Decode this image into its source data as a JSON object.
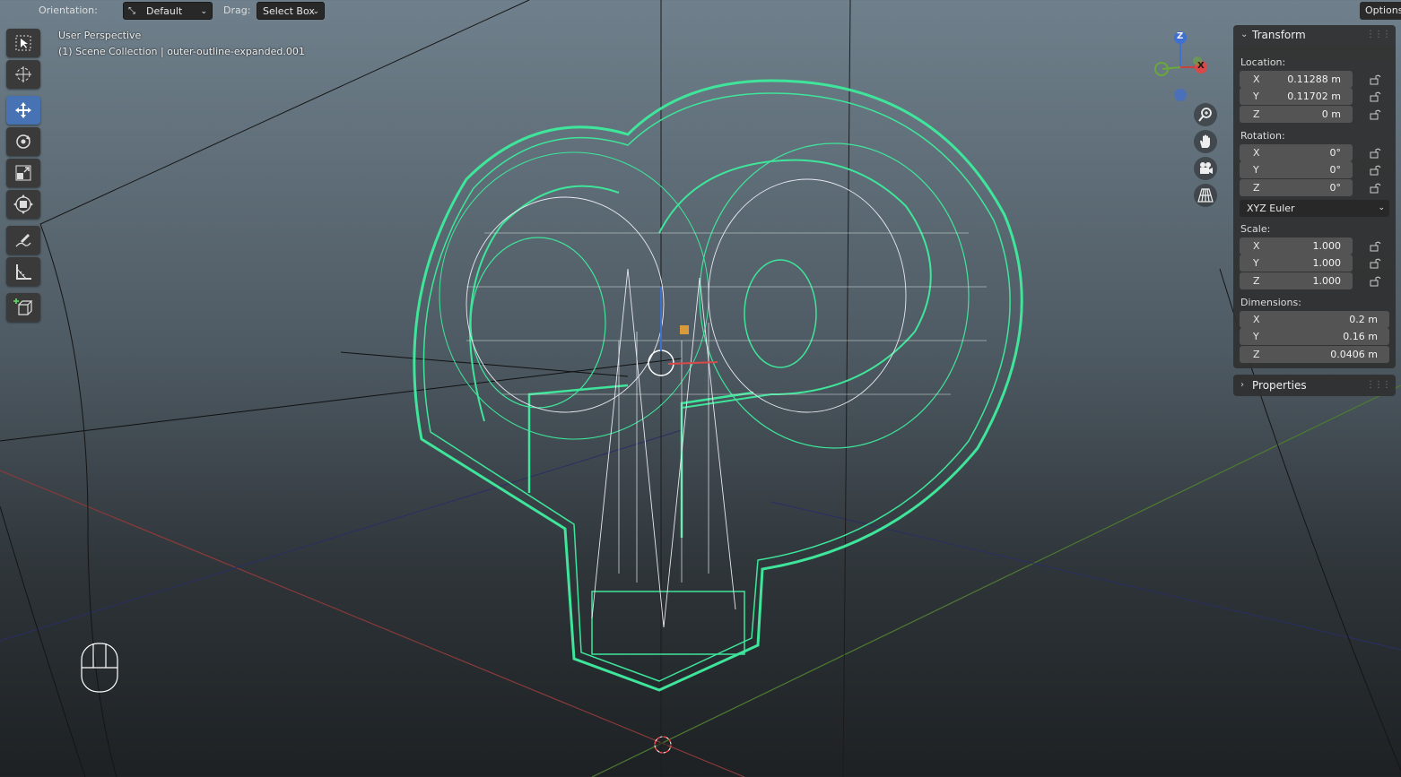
{
  "header": {
    "orientation_label": "Orientation:",
    "orientation_value": "Default",
    "drag_label": "Drag:",
    "drag_value": "Select Box",
    "options_label": "Options"
  },
  "viewport": {
    "perspective_label": "User Perspective",
    "collection_label": "(1) Scene Collection | outer-outline-expanded.001"
  },
  "gizmo": {
    "z_label": "Z",
    "x_label": "X"
  },
  "toolbar": {
    "tools": [
      "select-box",
      "cursor",
      "move",
      "rotate",
      "scale",
      "transform",
      "annotate",
      "measure",
      "add-cube"
    ],
    "active_tool": "move"
  },
  "transform_panel": {
    "title": "Transform",
    "location_label": "Location:",
    "location": [
      {
        "axis": "X",
        "value": "0.11288 m"
      },
      {
        "axis": "Y",
        "value": "0.11702 m"
      },
      {
        "axis": "Z",
        "value": "0 m"
      }
    ],
    "rotation_label": "Rotation:",
    "rotation": [
      {
        "axis": "X",
        "value": "0°"
      },
      {
        "axis": "Y",
        "value": "0°"
      },
      {
        "axis": "Z",
        "value": "0°"
      }
    ],
    "rotation_mode": "XYZ Euler",
    "scale_label": "Scale:",
    "scale": [
      {
        "axis": "X",
        "value": "1.000"
      },
      {
        "axis": "Y",
        "value": "1.000"
      },
      {
        "axis": "Z",
        "value": "1.000"
      }
    ],
    "dimensions_label": "Dimensions:",
    "dimensions": [
      {
        "axis": "X",
        "value": "0.2 m"
      },
      {
        "axis": "Y",
        "value": "0.16 m"
      },
      {
        "axis": "Z",
        "value": "0.0406 m"
      }
    ]
  },
  "properties_panel": {
    "title": "Properties"
  },
  "colors": {
    "wire_selected": "#3ee59a",
    "wire_inner": "#e8e8f0",
    "active_tool": "#4772b3",
    "axis_x": "#c84040",
    "axis_y": "#6aa83a",
    "axis_z": "#3f6fd0"
  }
}
